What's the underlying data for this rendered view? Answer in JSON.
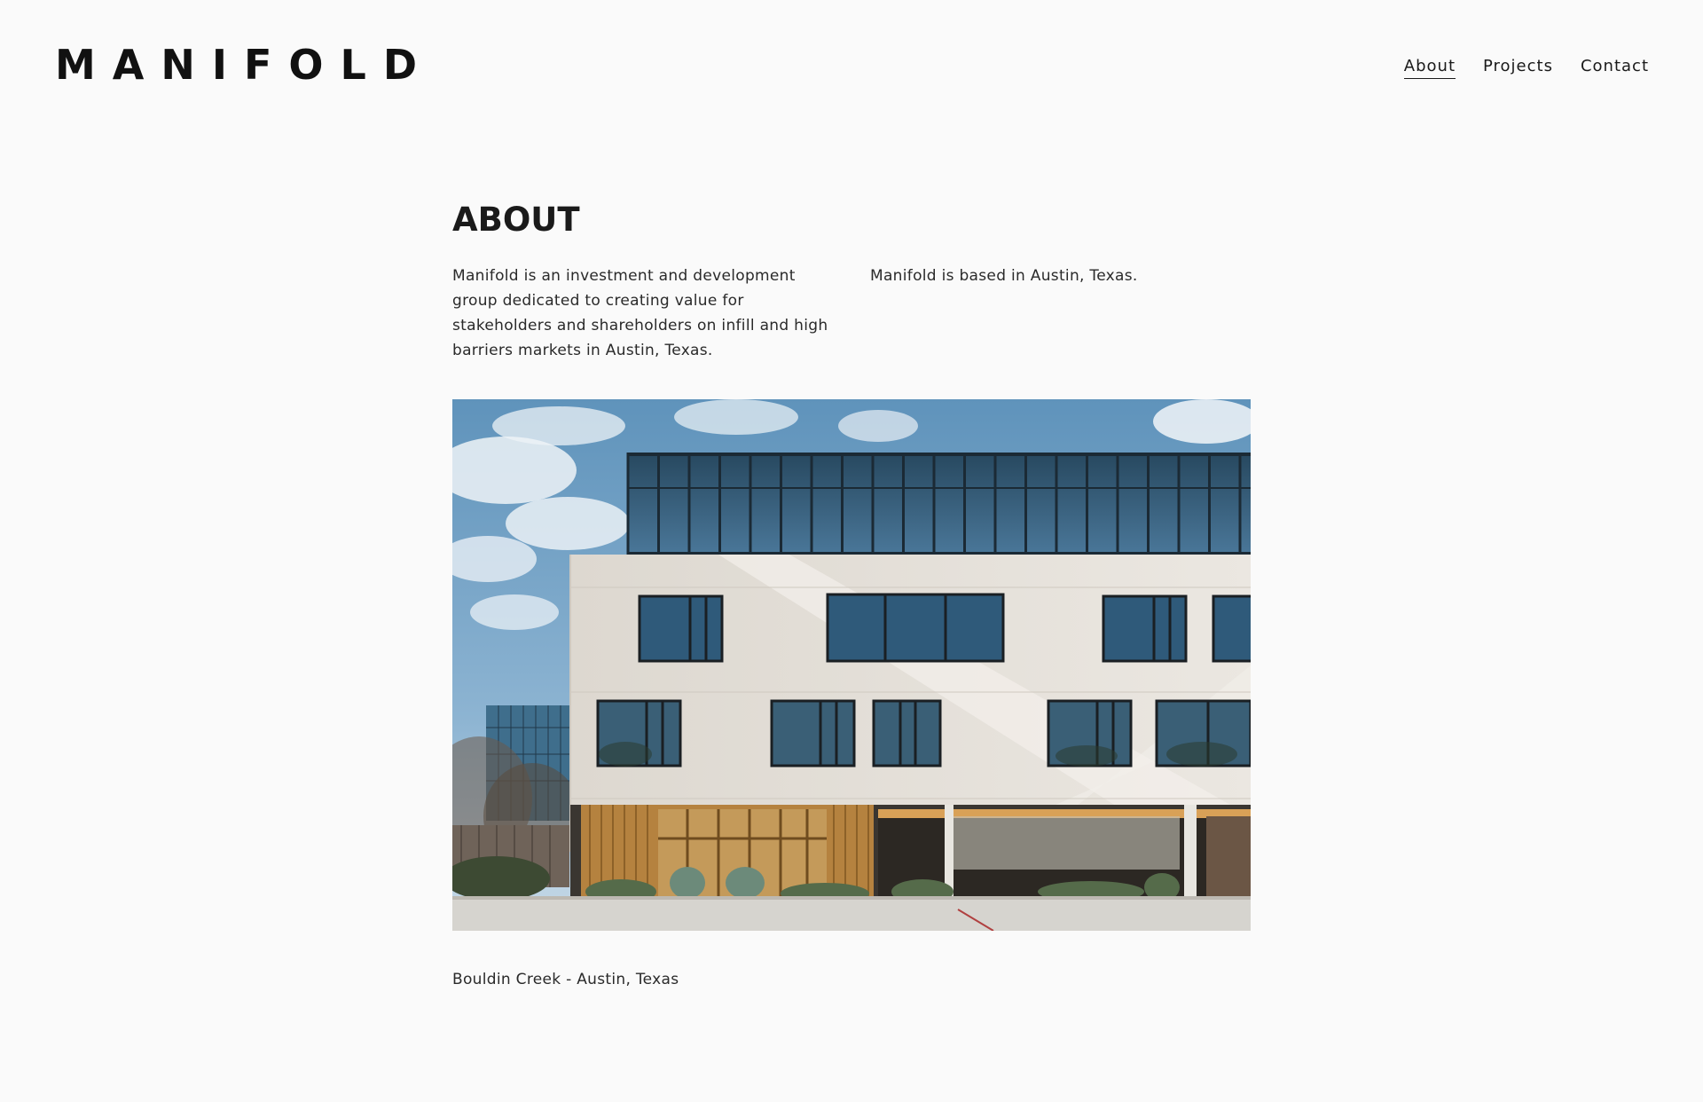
{
  "header": {
    "logo": "MANIFOLD",
    "nav": [
      {
        "label": "About",
        "active": true
      },
      {
        "label": "Projects",
        "active": false
      },
      {
        "label": "Contact",
        "active": false
      }
    ]
  },
  "main": {
    "title": "ABOUT",
    "intro_left": "Manifold is an investment and development group dedicated to creating value for stakeholders and shareholders on infill and high barriers markets in Austin, Texas.",
    "intro_right": "Manifold is based in Austin, Texas.",
    "image_caption": "Bouldin Creek - Austin, Texas"
  },
  "colors": {
    "background": "#fafafa",
    "text": "#1a1a1a",
    "sky": "#6a9cc0",
    "facade": "#e4e0da",
    "glass": "#2f5470",
    "wood": "#b5823f"
  }
}
